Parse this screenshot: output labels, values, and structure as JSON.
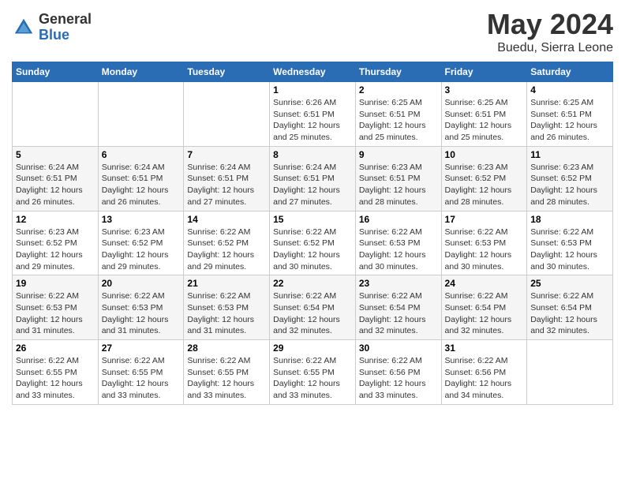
{
  "header": {
    "logo_general": "General",
    "logo_blue": "Blue",
    "title": "May 2024",
    "subtitle": "Buedu, Sierra Leone"
  },
  "weekdays": [
    "Sunday",
    "Monday",
    "Tuesday",
    "Wednesday",
    "Thursday",
    "Friday",
    "Saturday"
  ],
  "weeks": [
    [
      {
        "day": "",
        "sunrise": "",
        "sunset": "",
        "daylight": ""
      },
      {
        "day": "",
        "sunrise": "",
        "sunset": "",
        "daylight": ""
      },
      {
        "day": "",
        "sunrise": "",
        "sunset": "",
        "daylight": ""
      },
      {
        "day": "1",
        "sunrise": "Sunrise: 6:26 AM",
        "sunset": "Sunset: 6:51 PM",
        "daylight": "Daylight: 12 hours and 25 minutes."
      },
      {
        "day": "2",
        "sunrise": "Sunrise: 6:25 AM",
        "sunset": "Sunset: 6:51 PM",
        "daylight": "Daylight: 12 hours and 25 minutes."
      },
      {
        "day": "3",
        "sunrise": "Sunrise: 6:25 AM",
        "sunset": "Sunset: 6:51 PM",
        "daylight": "Daylight: 12 hours and 25 minutes."
      },
      {
        "day": "4",
        "sunrise": "Sunrise: 6:25 AM",
        "sunset": "Sunset: 6:51 PM",
        "daylight": "Daylight: 12 hours and 26 minutes."
      }
    ],
    [
      {
        "day": "5",
        "sunrise": "Sunrise: 6:24 AM",
        "sunset": "Sunset: 6:51 PM",
        "daylight": "Daylight: 12 hours and 26 minutes."
      },
      {
        "day": "6",
        "sunrise": "Sunrise: 6:24 AM",
        "sunset": "Sunset: 6:51 PM",
        "daylight": "Daylight: 12 hours and 26 minutes."
      },
      {
        "day": "7",
        "sunrise": "Sunrise: 6:24 AM",
        "sunset": "Sunset: 6:51 PM",
        "daylight": "Daylight: 12 hours and 27 minutes."
      },
      {
        "day": "8",
        "sunrise": "Sunrise: 6:24 AM",
        "sunset": "Sunset: 6:51 PM",
        "daylight": "Daylight: 12 hours and 27 minutes."
      },
      {
        "day": "9",
        "sunrise": "Sunrise: 6:23 AM",
        "sunset": "Sunset: 6:51 PM",
        "daylight": "Daylight: 12 hours and 28 minutes."
      },
      {
        "day": "10",
        "sunrise": "Sunrise: 6:23 AM",
        "sunset": "Sunset: 6:52 PM",
        "daylight": "Daylight: 12 hours and 28 minutes."
      },
      {
        "day": "11",
        "sunrise": "Sunrise: 6:23 AM",
        "sunset": "Sunset: 6:52 PM",
        "daylight": "Daylight: 12 hours and 28 minutes."
      }
    ],
    [
      {
        "day": "12",
        "sunrise": "Sunrise: 6:23 AM",
        "sunset": "Sunset: 6:52 PM",
        "daylight": "Daylight: 12 hours and 29 minutes."
      },
      {
        "day": "13",
        "sunrise": "Sunrise: 6:23 AM",
        "sunset": "Sunset: 6:52 PM",
        "daylight": "Daylight: 12 hours and 29 minutes."
      },
      {
        "day": "14",
        "sunrise": "Sunrise: 6:22 AM",
        "sunset": "Sunset: 6:52 PM",
        "daylight": "Daylight: 12 hours and 29 minutes."
      },
      {
        "day": "15",
        "sunrise": "Sunrise: 6:22 AM",
        "sunset": "Sunset: 6:52 PM",
        "daylight": "Daylight: 12 hours and 30 minutes."
      },
      {
        "day": "16",
        "sunrise": "Sunrise: 6:22 AM",
        "sunset": "Sunset: 6:53 PM",
        "daylight": "Daylight: 12 hours and 30 minutes."
      },
      {
        "day": "17",
        "sunrise": "Sunrise: 6:22 AM",
        "sunset": "Sunset: 6:53 PM",
        "daylight": "Daylight: 12 hours and 30 minutes."
      },
      {
        "day": "18",
        "sunrise": "Sunrise: 6:22 AM",
        "sunset": "Sunset: 6:53 PM",
        "daylight": "Daylight: 12 hours and 30 minutes."
      }
    ],
    [
      {
        "day": "19",
        "sunrise": "Sunrise: 6:22 AM",
        "sunset": "Sunset: 6:53 PM",
        "daylight": "Daylight: 12 hours and 31 minutes."
      },
      {
        "day": "20",
        "sunrise": "Sunrise: 6:22 AM",
        "sunset": "Sunset: 6:53 PM",
        "daylight": "Daylight: 12 hours and 31 minutes."
      },
      {
        "day": "21",
        "sunrise": "Sunrise: 6:22 AM",
        "sunset": "Sunset: 6:53 PM",
        "daylight": "Daylight: 12 hours and 31 minutes."
      },
      {
        "day": "22",
        "sunrise": "Sunrise: 6:22 AM",
        "sunset": "Sunset: 6:54 PM",
        "daylight": "Daylight: 12 hours and 32 minutes."
      },
      {
        "day": "23",
        "sunrise": "Sunrise: 6:22 AM",
        "sunset": "Sunset: 6:54 PM",
        "daylight": "Daylight: 12 hours and 32 minutes."
      },
      {
        "day": "24",
        "sunrise": "Sunrise: 6:22 AM",
        "sunset": "Sunset: 6:54 PM",
        "daylight": "Daylight: 12 hours and 32 minutes."
      },
      {
        "day": "25",
        "sunrise": "Sunrise: 6:22 AM",
        "sunset": "Sunset: 6:54 PM",
        "daylight": "Daylight: 12 hours and 32 minutes."
      }
    ],
    [
      {
        "day": "26",
        "sunrise": "Sunrise: 6:22 AM",
        "sunset": "Sunset: 6:55 PM",
        "daylight": "Daylight: 12 hours and 33 minutes."
      },
      {
        "day": "27",
        "sunrise": "Sunrise: 6:22 AM",
        "sunset": "Sunset: 6:55 PM",
        "daylight": "Daylight: 12 hours and 33 minutes."
      },
      {
        "day": "28",
        "sunrise": "Sunrise: 6:22 AM",
        "sunset": "Sunset: 6:55 PM",
        "daylight": "Daylight: 12 hours and 33 minutes."
      },
      {
        "day": "29",
        "sunrise": "Sunrise: 6:22 AM",
        "sunset": "Sunset: 6:55 PM",
        "daylight": "Daylight: 12 hours and 33 minutes."
      },
      {
        "day": "30",
        "sunrise": "Sunrise: 6:22 AM",
        "sunset": "Sunset: 6:56 PM",
        "daylight": "Daylight: 12 hours and 33 minutes."
      },
      {
        "day": "31",
        "sunrise": "Sunrise: 6:22 AM",
        "sunset": "Sunset: 6:56 PM",
        "daylight": "Daylight: 12 hours and 34 minutes."
      },
      {
        "day": "",
        "sunrise": "",
        "sunset": "",
        "daylight": ""
      }
    ]
  ]
}
